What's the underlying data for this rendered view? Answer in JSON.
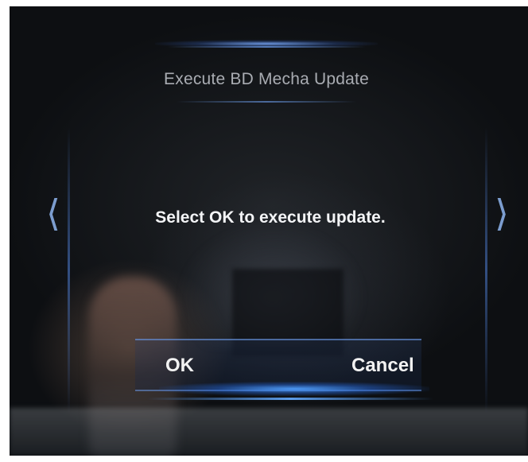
{
  "dialog": {
    "title": "Execute BD Mecha Update",
    "message": "Select OK to execute update.",
    "ok_label": "OK",
    "cancel_label": "Cancel"
  },
  "navigation": {
    "left_arrow_icon": "chevron-left-icon",
    "right_arrow_icon": "chevron-right-icon",
    "left_glyph": "⟨",
    "right_glyph": "⟩"
  },
  "colors": {
    "accent": "#6aa8ff",
    "background": "#111316",
    "title_text": "#a9acb2",
    "message_text": "#f3f4f6"
  }
}
